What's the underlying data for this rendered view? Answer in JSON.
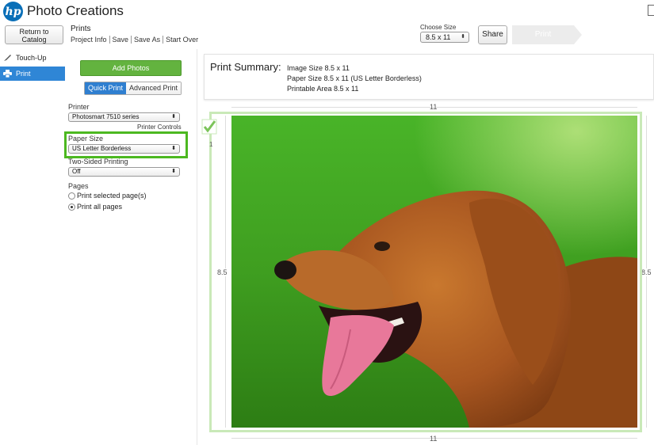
{
  "app": {
    "logo_text": "hp",
    "title": "Photo Creations"
  },
  "header": {
    "return_line1": "Return to",
    "return_line2": "Catalog",
    "doc_type": "Prints",
    "menu": [
      "Project Info",
      "Save",
      "Save As",
      "Start Over"
    ],
    "choose_size_label": "Choose Size",
    "choose_size_value": "8.5 x 11",
    "share_label": "Share",
    "print_label": "Print"
  },
  "nav": {
    "touchup": "Touch-Up",
    "print": "Print"
  },
  "panel": {
    "add_photos": "Add Photos",
    "tabs": [
      "Quick Print",
      "Advanced Print"
    ],
    "printer_label": "Printer",
    "printer_value": "Photosmart 7510 series",
    "printer_controls": "Printer Controls",
    "paper_label": "Paper Size",
    "paper_value": "US Letter Borderless",
    "twosided_label": "Two-Sided Printing",
    "twosided_value": "Off",
    "pages_label": "Pages",
    "pages_options": [
      "Print selected page(s)",
      "Print all pages"
    ],
    "pages_selected": 1
  },
  "summary": {
    "title": "Print Summary:",
    "image_size": "Image Size 8.5 x 11",
    "paper_size": "Paper Size 8.5 x 11 (US Letter Borderless)",
    "printable_area": "Printable Area 8.5 x 11"
  },
  "preview": {
    "width_label": "11",
    "height_label": "8.5",
    "page_number": "1"
  },
  "colors": {
    "accent_blue": "#2f86d6",
    "green": "#63b33f",
    "highlight": "#4cb820"
  }
}
